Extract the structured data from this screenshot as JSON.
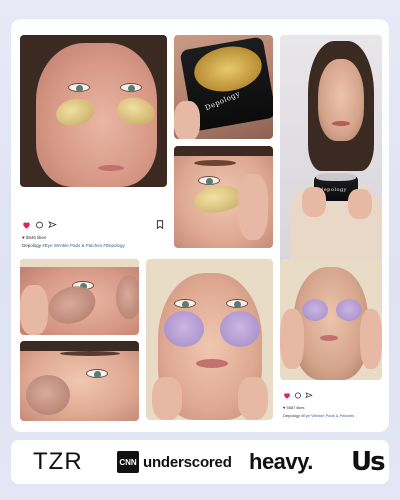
{
  "feed": {
    "post_left": {
      "likes": "♥ 5846 likes",
      "handle": "Depology",
      "caption": "#Eye Wrinkle Pads & Patches  #Depology"
    },
    "post_right": {
      "likes": "♥ 5587 likes",
      "handle": "Depology",
      "caption": "#Eye Wrinkle Pads & Patches"
    },
    "jar_label_top": "Depology",
    "jar_label_side": "depology",
    "colors": {
      "like_heart": "#e0245e",
      "icon_stroke": "#222222"
    },
    "icons": [
      "heart-icon",
      "comment-icon",
      "share-icon",
      "bookmark-icon"
    ]
  },
  "press": {
    "logos": {
      "tzr": "TZR",
      "cnn_box": "CNN",
      "underscored": "underscored",
      "heavy": "heavy.",
      "us": "Us"
    }
  }
}
